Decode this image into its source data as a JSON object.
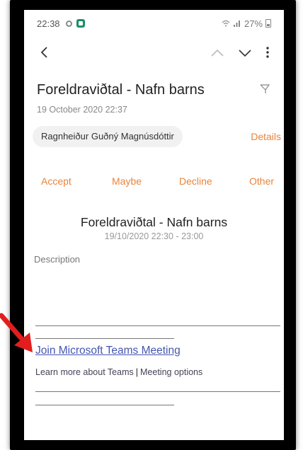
{
  "status_bar": {
    "time": "22:38",
    "battery": "27%"
  },
  "email": {
    "subject": "Foreldraviðtal - Nafn barns",
    "date": "19 October 2020 22:37",
    "sender": "Ragnheiður Guðný Magnúsdóttir",
    "details_label": "Details"
  },
  "actions": {
    "accept": "Accept",
    "maybe": "Maybe",
    "decline": "Decline",
    "other": "Other"
  },
  "event": {
    "title": "Foreldraviðtal - Nafn barns",
    "time_range": "19/10/2020 22:30 - 23:00"
  },
  "body": {
    "description_label": "Description",
    "join_link": "Join Microsoft Teams Meeting",
    "learn_more": "Learn more about Teams",
    "separator": "|",
    "meeting_options": "Meeting options"
  },
  "colors": {
    "accent": "#e8843b",
    "link": "#4456b0",
    "annotation_arrow": "#e11d1d"
  },
  "icons": {
    "back": "back-arrow-icon",
    "up": "chevron-up-icon",
    "down": "chevron-down-icon",
    "more": "more-vertical-icon",
    "flag": "flag-icon",
    "annotation": "red-arrow-icon"
  }
}
